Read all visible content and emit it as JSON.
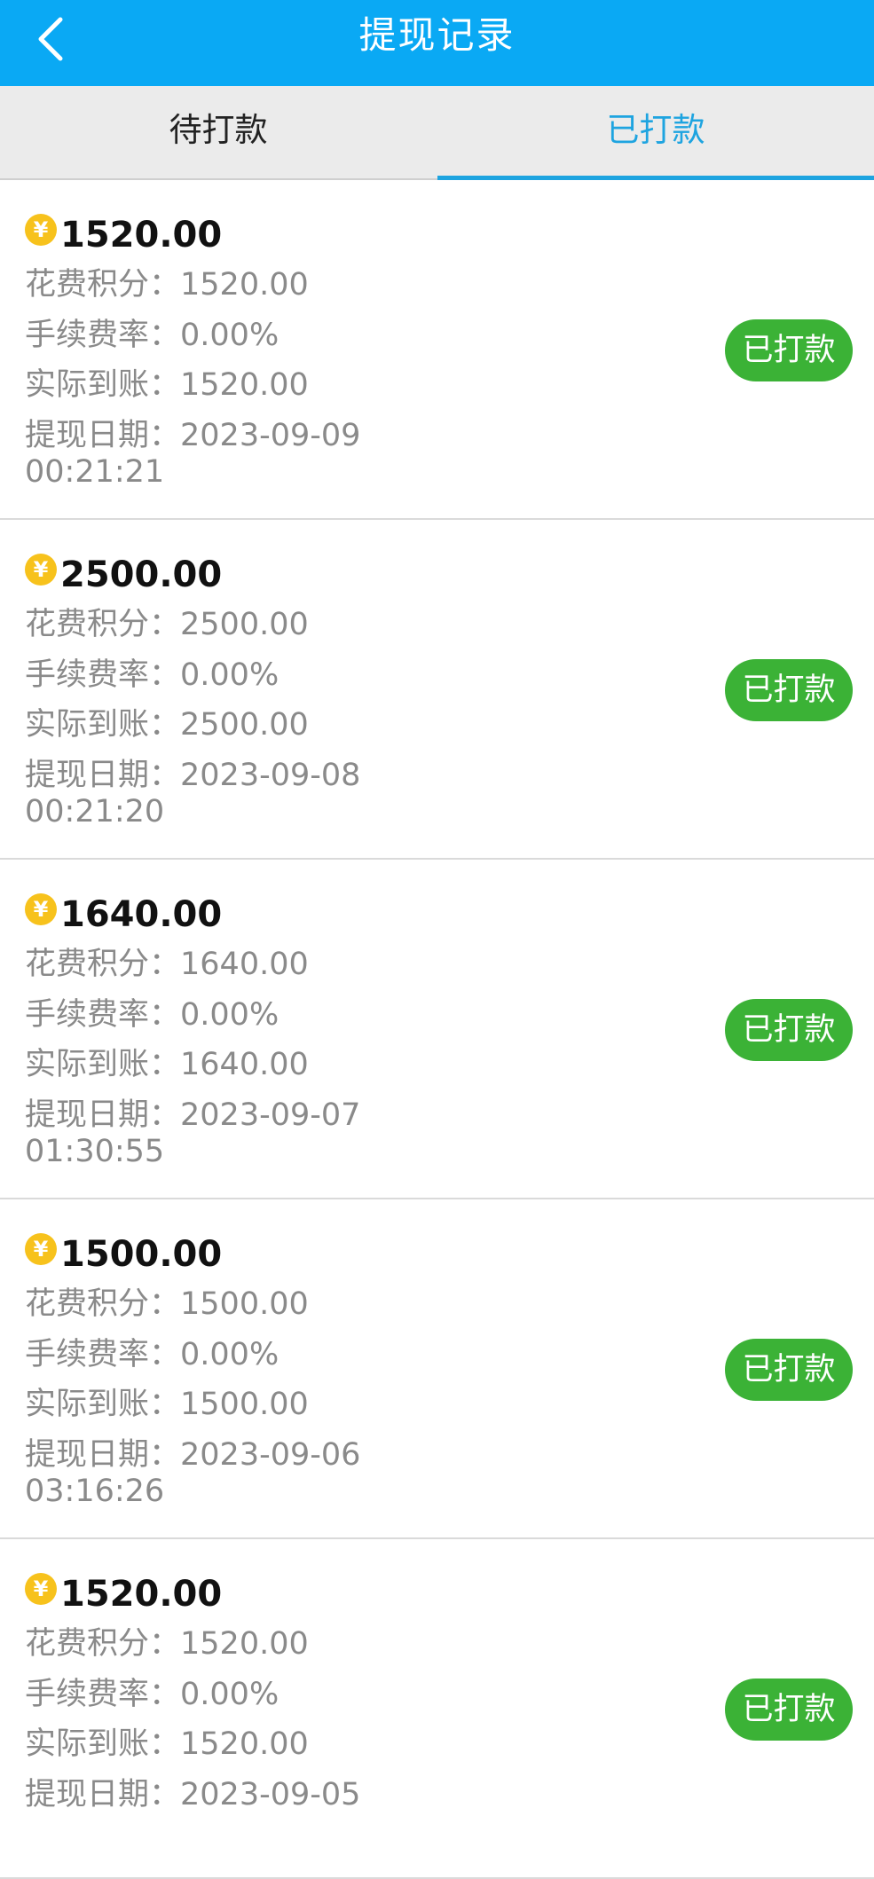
{
  "header": {
    "title": "提现记录"
  },
  "tabs": [
    {
      "label": "待打款"
    },
    {
      "label": "已打款"
    }
  ],
  "labels": {
    "points": "花费积分：",
    "fee": "手续费率：",
    "actual": "实际到账：",
    "date": "提现日期："
  },
  "coin_symbol": "¥",
  "records": [
    {
      "amount": "1520.00",
      "points": "1520.00",
      "fee": "0.00%",
      "actual": "1520.00",
      "date": "2023-09-09",
      "time": "00:21:21",
      "status": "已打款"
    },
    {
      "amount": "2500.00",
      "points": "2500.00",
      "fee": "0.00%",
      "actual": "2500.00",
      "date": "2023-09-08",
      "time": "00:21:20",
      "status": "已打款"
    },
    {
      "amount": "1640.00",
      "points": "1640.00",
      "fee": "0.00%",
      "actual": "1640.00",
      "date": "2023-09-07",
      "time": "01:30:55",
      "status": "已打款"
    },
    {
      "amount": "1500.00",
      "points": "1500.00",
      "fee": "0.00%",
      "actual": "1500.00",
      "date": "2023-09-06",
      "time": "03:16:26",
      "status": "已打款"
    },
    {
      "amount": "1520.00",
      "points": "1520.00",
      "fee": "0.00%",
      "actual": "1520.00",
      "date": "2023-09-05",
      "time": "",
      "status": "已打款"
    }
  ]
}
